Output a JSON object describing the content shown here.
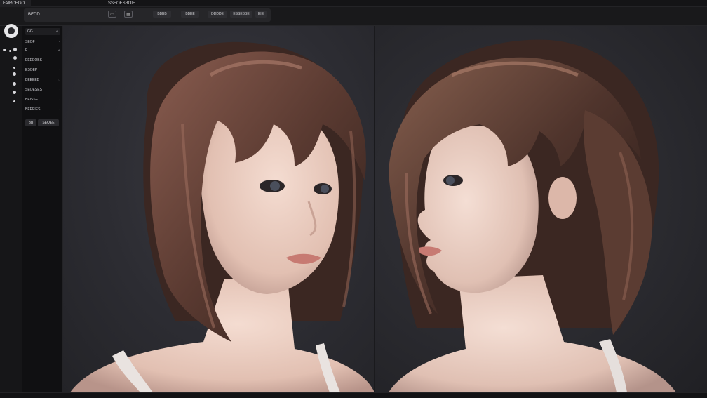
{
  "tabs": [
    {
      "label": "FAIRCEGO",
      "active": true
    },
    {
      "label": "SSEOESBOIE",
      "active": false
    }
  ],
  "toolbar": {
    "app_name": "BEDD",
    "icons": [
      "image-icon",
      "grid-icon"
    ],
    "buttons": [
      "BBBB",
      "BBEE",
      "DDDDE",
      "ESSEBBE"
    ],
    "close_label": "EIE"
  },
  "panel": {
    "header": "GG",
    "rows": [
      {
        "label": "SEOF",
        "ctl": "◔"
      },
      {
        "label": "E",
        "ctl": "◐"
      },
      {
        "label": "EEEEOBS",
        "ctl": "|"
      },
      {
        "label": "ESOEP",
        "ctl": "·"
      },
      {
        "label": "BEEEEB",
        "ctl": "◌"
      },
      {
        "label": "SEOESES",
        "ctl": "·"
      },
      {
        "label": "BEISSE",
        "ctl": "·"
      },
      {
        "label": "BEEEIES",
        "ctl": "·"
      }
    ],
    "buttons": [
      "BB",
      "SEOEE"
    ]
  },
  "colors": {
    "background": "#1b1b1d",
    "hair_dark": "#3b2722",
    "hair_light": "#7a5246",
    "skin": "#ecd2c6",
    "lips": "#c77a72",
    "eyes": "#4a4f5c"
  }
}
